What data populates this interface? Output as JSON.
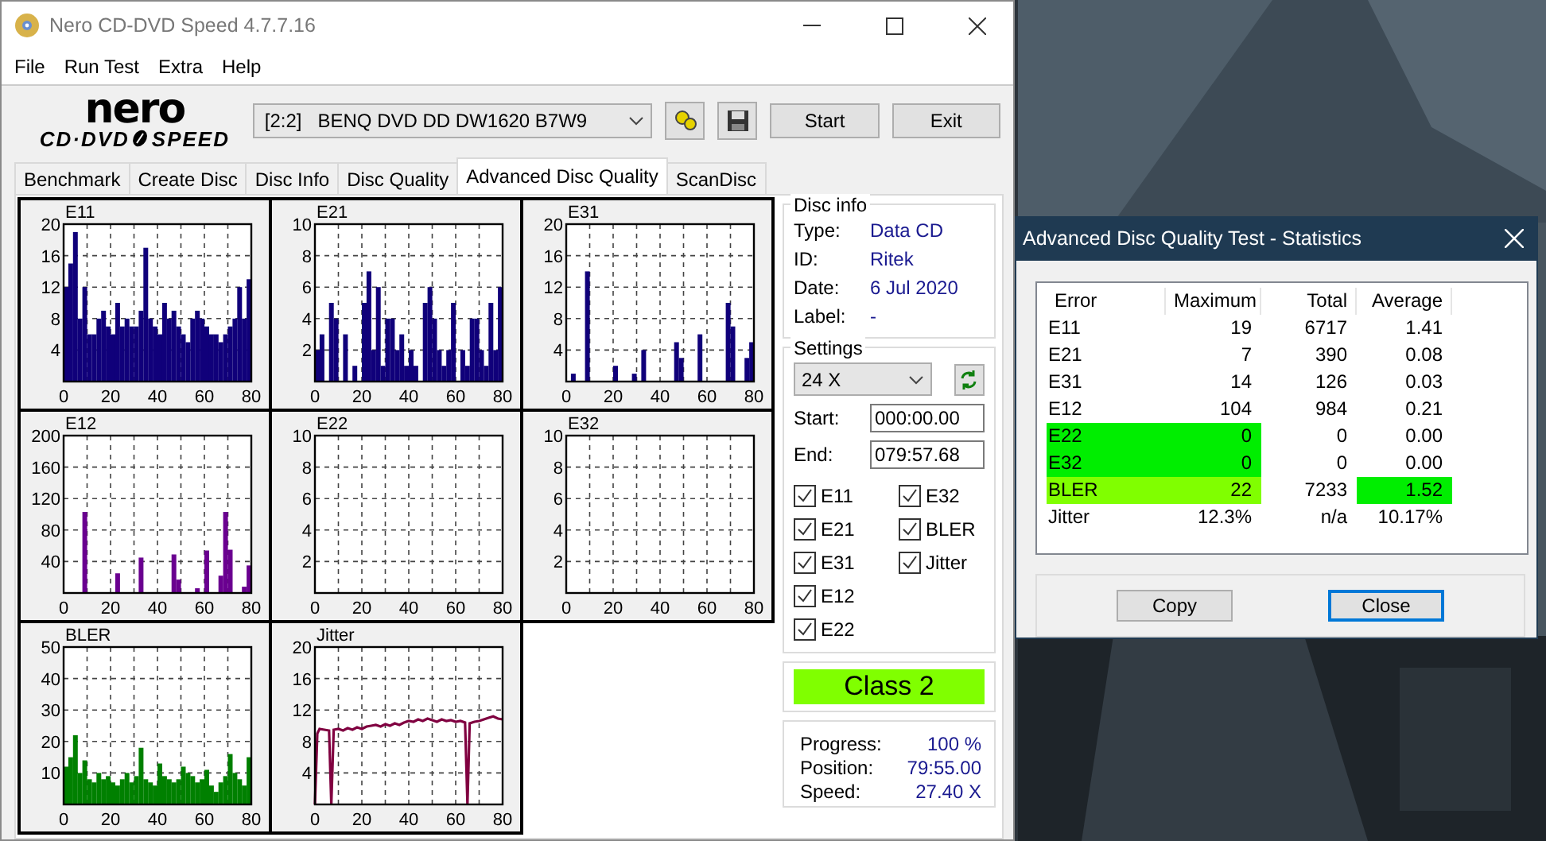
{
  "window": {
    "title": "Nero CD-DVD Speed 4.7.7.16"
  },
  "menu": [
    "File",
    "Run Test",
    "Extra",
    "Help"
  ],
  "logo": {
    "brand": "nero",
    "product_left": "CD·DVD",
    "product_right": "SPEED"
  },
  "drive": {
    "value": "[2:2]   BENQ DVD DD DW1620 B7W9"
  },
  "toolbar_buttons": [
    "Start",
    "Exit"
  ],
  "tabs": [
    {
      "label": "Benchmark",
      "selected": false
    },
    {
      "label": "Create Disc",
      "selected": false
    },
    {
      "label": "Disc Info",
      "selected": false
    },
    {
      "label": "Disc Quality",
      "selected": false
    },
    {
      "label": "Advanced Disc Quality",
      "selected": true
    },
    {
      "label": "ScanDisc",
      "selected": false
    }
  ],
  "charts": [
    {
      "chart_data": {
        "type": "bar",
        "title": "E11",
        "color": "#10007a",
        "x": [
          0,
          2,
          4,
          6,
          8,
          10,
          12,
          14,
          16,
          18,
          20,
          22,
          24,
          26,
          28,
          30,
          32,
          34,
          36,
          38,
          40,
          42,
          44,
          46,
          48,
          50,
          52,
          54,
          56,
          58,
          60,
          62,
          64,
          66,
          68,
          70,
          72,
          74,
          76,
          78
        ],
        "values": [
          12,
          15,
          19,
          8,
          12,
          6,
          6,
          8,
          9,
          7,
          6,
          10,
          7,
          8,
          7,
          7,
          9,
          17,
          8,
          7,
          6,
          10,
          8,
          9,
          7,
          6,
          5,
          8,
          9,
          8,
          7,
          6,
          6,
          5,
          6,
          7,
          8,
          12,
          8,
          13
        ],
        "xlim": [
          0,
          80
        ],
        "ylim": [
          0,
          20
        ],
        "yticks": [
          4,
          8,
          12,
          16,
          20
        ],
        "xticks": [
          0,
          20,
          40,
          60,
          80
        ],
        "grid": true
      }
    },
    {
      "chart_data": {
        "type": "bar",
        "title": "E21",
        "color": "#10007a",
        "x": [
          0,
          2,
          6,
          8,
          12,
          16,
          20,
          22,
          24,
          26,
          28,
          30,
          32,
          34,
          36,
          38,
          40,
          42,
          46,
          48,
          50,
          52,
          54,
          56,
          58,
          62,
          64,
          66,
          68,
          70,
          72,
          74,
          76,
          78
        ],
        "values": [
          2,
          3,
          5,
          4,
          3,
          1,
          5,
          7,
          2,
          6,
          1,
          4,
          4,
          2,
          3,
          1,
          2,
          1,
          5,
          6,
          4,
          2,
          1,
          2,
          5,
          2,
          1,
          4,
          4,
          2,
          1,
          5,
          2,
          6
        ],
        "xlim": [
          0,
          80
        ],
        "ylim": [
          0,
          10
        ],
        "yticks": [
          2,
          4,
          6,
          8,
          10
        ],
        "xticks": [
          0,
          20,
          40,
          60,
          80
        ],
        "grid": true
      }
    },
    {
      "chart_data": {
        "type": "bar",
        "title": "E31",
        "color": "#10007a",
        "x": [
          2,
          8,
          20,
          28,
          32,
          46,
          48,
          56,
          68,
          70,
          76,
          78
        ],
        "values": [
          1,
          14,
          2,
          1,
          4,
          5,
          3,
          6,
          10,
          7,
          3,
          5
        ],
        "xlim": [
          0,
          80
        ],
        "ylim": [
          0,
          20
        ],
        "yticks": [
          4,
          8,
          12,
          16,
          20
        ],
        "xticks": [
          0,
          20,
          40,
          60,
          80
        ],
        "grid": true
      }
    },
    {
      "chart_data": {
        "type": "bar",
        "title": "E12",
        "color": "#6a0090",
        "x": [
          8,
          22,
          32,
          46,
          48,
          56,
          60,
          66,
          68,
          70,
          76,
          78
        ],
        "values": [
          103,
          25,
          45,
          49,
          17,
          6,
          54,
          22,
          103,
          55,
          8,
          35
        ],
        "xlim": [
          0,
          80
        ],
        "ylim": [
          0,
          200
        ],
        "yticks": [
          40,
          80,
          120,
          160,
          200
        ],
        "xticks": [
          0,
          20,
          40,
          60,
          80
        ],
        "grid": true
      }
    },
    {
      "chart_data": {
        "type": "bar",
        "title": "E22",
        "xlim": [
          0,
          80
        ],
        "ylim": [
          0,
          10
        ],
        "yticks": [
          2,
          4,
          6,
          8,
          10
        ],
        "xticks": [
          0,
          20,
          40,
          60,
          80
        ],
        "grid": true
      }
    },
    {
      "chart_data": {
        "type": "bar",
        "title": "E32",
        "xlim": [
          0,
          80
        ],
        "ylim": [
          0,
          10
        ],
        "yticks": [
          2,
          4,
          6,
          8,
          10
        ],
        "xticks": [
          0,
          20,
          40,
          60,
          80
        ],
        "grid": true
      }
    },
    {
      "chart_data": {
        "type": "bar",
        "title": "BLER",
        "color": "#008000",
        "x": [
          0,
          2,
          4,
          6,
          8,
          10,
          12,
          14,
          16,
          18,
          20,
          22,
          24,
          26,
          28,
          30,
          32,
          34,
          36,
          38,
          40,
          42,
          44,
          46,
          48,
          50,
          52,
          54,
          56,
          58,
          60,
          62,
          64,
          66,
          68,
          70,
          72,
          74,
          76,
          78
        ],
        "values": [
          12,
          15,
          22,
          10,
          14,
          8,
          7,
          10,
          8,
          9,
          7,
          6,
          8,
          10,
          7,
          9,
          18,
          8,
          7,
          6,
          13,
          9,
          8,
          7,
          8,
          12,
          10,
          9,
          7,
          8,
          11,
          6,
          4,
          7,
          9,
          16,
          10,
          8,
          6,
          15
        ],
        "xlim": [
          0,
          80
        ],
        "ylim": [
          0,
          50
        ],
        "yticks": [
          10,
          20,
          30,
          40,
          50
        ],
        "xticks": [
          0,
          20,
          40,
          60,
          80
        ],
        "grid": true
      }
    },
    {
      "chart_data": {
        "type": "line",
        "title": "Jitter",
        "color": "#800040",
        "x": [
          0,
          1,
          2,
          4,
          6,
          7,
          8,
          10,
          12,
          14,
          16,
          18,
          20,
          22,
          24,
          26,
          28,
          30,
          32,
          34,
          36,
          38,
          40,
          42,
          44,
          46,
          48,
          50,
          52,
          54,
          56,
          58,
          60,
          62,
          64,
          65,
          66,
          67,
          68,
          70,
          72,
          74,
          76,
          78,
          80
        ],
        "values": [
          0,
          9,
          9.6,
          9.5,
          9.4,
          0,
          9.5,
          9.6,
          9.4,
          9.7,
          9.5,
          9.8,
          9.6,
          9.9,
          10,
          10.1,
          9.9,
          10.2,
          10,
          10.3,
          10.1,
          10.4,
          10.6,
          10.5,
          10.8,
          10.6,
          10.9,
          10.7,
          10.5,
          10.8,
          10.6,
          10.7,
          10.5,
          10.6,
          10.4,
          0,
          10.3,
          10.4,
          10.5,
          10.6,
          10.8,
          11,
          11.2,
          10.9,
          10.8
        ],
        "xlim": [
          0,
          80
        ],
        "ylim": [
          0,
          20
        ],
        "yticks": [
          4,
          8,
          12,
          16,
          20
        ],
        "xticks": [
          0,
          20,
          40,
          60,
          80
        ],
        "grid": true
      }
    }
  ],
  "disc_info": {
    "title": "Disc info",
    "fields": [
      {
        "label": "Type:",
        "value": "Data CD"
      },
      {
        "label": "ID:",
        "value": "Ritek"
      },
      {
        "label": "Date:",
        "value": "6 Jul 2020"
      },
      {
        "label": "Label:",
        "value": "-"
      }
    ]
  },
  "settings": {
    "title": "Settings",
    "speed": "24 X",
    "start_label": "Start:",
    "start": "000:00.00",
    "end_label": "End:",
    "end": "079:57.68",
    "checkbox_columns": [
      [
        {
          "label": "E11",
          "checked": true
        },
        {
          "label": "E21",
          "checked": true
        },
        {
          "label": "E31",
          "checked": true
        },
        {
          "label": "E12",
          "checked": true
        },
        {
          "label": "E22",
          "checked": true
        }
      ],
      [
        {
          "label": "E32",
          "checked": true
        },
        {
          "label": "BLER",
          "checked": true
        },
        {
          "label": "Jitter",
          "checked": true
        }
      ]
    ]
  },
  "class_badge": {
    "text": "Class 2",
    "color": "#80ff00"
  },
  "progress": [
    {
      "label": "Progress:",
      "value": "100 %"
    },
    {
      "label": "Position:",
      "value": "79:55.00"
    },
    {
      "label": "Speed:",
      "value": "27.40 X"
    }
  ],
  "statistics": {
    "title": "Advanced Disc Quality Test - Statistics",
    "columns": [
      "Error",
      "Maximum",
      "Total",
      "Average"
    ],
    "rows": [
      {
        "cells": [
          {
            "text": "E11"
          },
          {
            "text": "19"
          },
          {
            "text": "6717"
          },
          {
            "text": "1.41"
          }
        ]
      },
      {
        "cells": [
          {
            "text": "E21"
          },
          {
            "text": "7"
          },
          {
            "text": "390"
          },
          {
            "text": "0.08"
          }
        ]
      },
      {
        "cells": [
          {
            "text": "E31"
          },
          {
            "text": "14"
          },
          {
            "text": "126"
          },
          {
            "text": "0.03"
          }
        ]
      },
      {
        "cells": [
          {
            "text": "E12"
          },
          {
            "text": "104"
          },
          {
            "text": "984"
          },
          {
            "text": "0.21"
          }
        ]
      },
      {
        "cells": [
          {
            "text": "E22",
            "color": "#00ee00"
          },
          {
            "text": "0",
            "color": "#00ee00"
          },
          {
            "text": "0"
          },
          {
            "text": "0.00"
          }
        ]
      },
      {
        "cells": [
          {
            "text": "E32",
            "color": "#00ee00"
          },
          {
            "text": "0",
            "color": "#00ee00"
          },
          {
            "text": "0"
          },
          {
            "text": "0.00"
          }
        ]
      },
      {
        "cells": [
          {
            "text": "BLER",
            "color": "#80ff00"
          },
          {
            "text": "22",
            "color": "#80ff00"
          },
          {
            "text": "7233"
          },
          {
            "text": "1.52",
            "color": "#00ee00"
          }
        ]
      },
      {
        "cells": [
          {
            "text": "Jitter"
          },
          {
            "text": "12.3%"
          },
          {
            "text": "n/a"
          },
          {
            "text": "10.17%"
          }
        ]
      }
    ],
    "buttons": [
      {
        "label": "Copy",
        "focused": false
      },
      {
        "label": "Close",
        "focused": true
      }
    ]
  }
}
